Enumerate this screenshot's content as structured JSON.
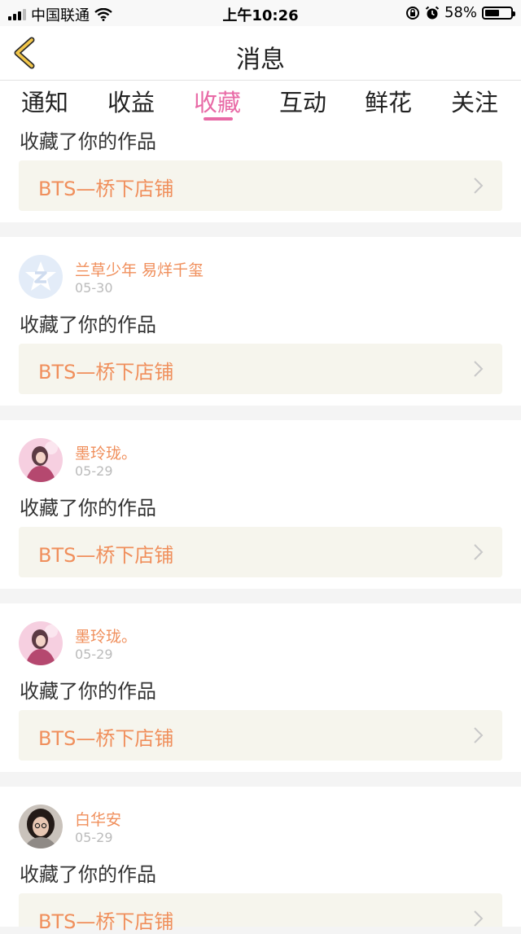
{
  "status_bar": {
    "carrier": "中国联通",
    "time": "上午10:26",
    "battery": "58%",
    "battery_level": 0.58
  },
  "nav": {
    "title": "消息",
    "back_icon": "chevron-left-icon"
  },
  "tabs": [
    {
      "label": "通知"
    },
    {
      "label": "收益"
    },
    {
      "label": "收藏",
      "active": true
    },
    {
      "label": "互动"
    },
    {
      "label": "鲜花"
    },
    {
      "label": "关注"
    }
  ],
  "accent_color": "#e86aa6",
  "name_color": "#f08f5c",
  "items": [
    {
      "action": "收藏了你的作品",
      "work": "BTS—桥下店铺"
    },
    {
      "user": "兰草少年 易烊千玺",
      "date": "05-30",
      "action": "收藏了你的作品",
      "work": "BTS—桥下店铺"
    },
    {
      "user": "墨玲珑。",
      "date": "05-29",
      "action": "收藏了你的作品",
      "work": "BTS—桥下店铺"
    },
    {
      "user": "墨玲珑。",
      "date": "05-29",
      "action": "收藏了你的作品",
      "work": "BTS—桥下店铺"
    },
    {
      "user": "白华安",
      "date": "05-29",
      "action": "收藏了你的作品",
      "work": "BTS—桥下店铺"
    }
  ]
}
